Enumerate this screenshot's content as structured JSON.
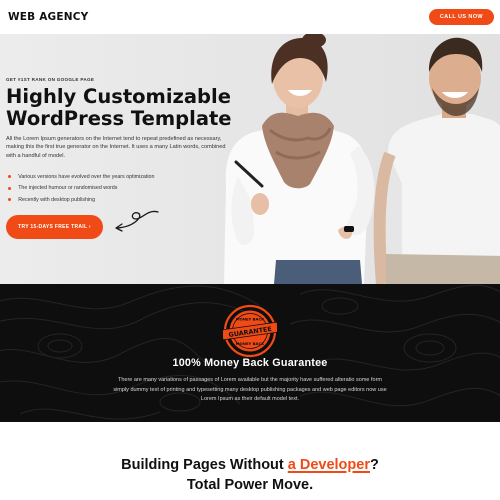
{
  "header": {
    "brand": "WEB AGENCY",
    "cta_label": "CALL US NOW"
  },
  "hero": {
    "eyebrow": "GET #1ST RANK ON GOOGLE PAGE",
    "headline_line1": "Highly Customizable",
    "headline_line2": "WordPress Template",
    "description": "All the Lorem Ipsum generators on the Internet tend to repeat predefined as necessary, making this the first true generator on the Internet. It uses a many Latin words, combined with a handful of model.",
    "bullets": [
      "Various versions have evolved over the years optimization",
      "The injected humour or randomised words",
      "Recently with desktop publishing"
    ],
    "cta_label": "TRY 15-DAYS FREE TRAIL ›",
    "image_alt": "two smiling people in white t-shirts"
  },
  "guarantee": {
    "badge_top": "MONEY BACK",
    "badge_main": "GUARANTEE",
    "badge_bottom": "MONEY BACK",
    "title": "100% Money Back Guarantee",
    "text": "There are many variations of passages of Lorem available but the majority have suffered alteratio some form simply dummy text of printing and typesetting many desktop publishing packages and web page editors now use Lorem Ipsum as their default model text."
  },
  "cta_section": {
    "title_part1": "Building Pages Without ",
    "title_highlight": "a Developer",
    "title_part2": "?",
    "title_line2": "Total Power Move."
  },
  "colors": {
    "accent": "#f04a17",
    "dark_bg": "#0e0e0e",
    "hero_bg": "#e8e8e8"
  }
}
